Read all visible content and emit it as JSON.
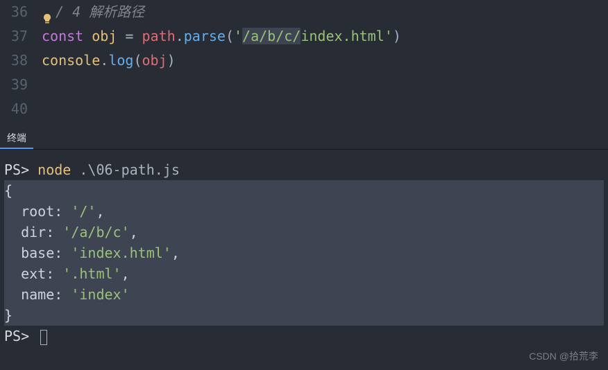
{
  "editor": {
    "line_numbers": [
      "36",
      "37",
      "38",
      "39",
      "40"
    ],
    "line36": {
      "bulb": "lightbulb-icon",
      "comment_marker": "/",
      "comment_num": " 4 ",
      "comment_text": "解析路径"
    },
    "line37": {
      "const": "const",
      "obj": "obj",
      "eq": " = ",
      "path": "path",
      "dot1": ".",
      "parse": "parse",
      "lparen": "(",
      "q1": "'",
      "str_hl": "/a/b/c/",
      "str_rest": "index.html",
      "q2": "'",
      "rparen": ")"
    },
    "line38": {
      "console": "console",
      "dot": ".",
      "log": "log",
      "lparen": "(",
      "obj": "obj",
      "rparen": ")"
    }
  },
  "terminal": {
    "tab_label": "终端",
    "prompt": "PS>",
    "cmd_name": "node",
    "cmd_arg": ".\\06-path.js",
    "output": {
      "open": "{",
      "root_key": "  root: ",
      "root_val": "'/'",
      "comma": ",",
      "dir_key": "  dir: ",
      "dir_val": "'/a/b/c'",
      "base_key": "  base: ",
      "base_val": "'index.html'",
      "ext_key": "  ext: ",
      "ext_val": "'.html'",
      "name_key": "  name: ",
      "name_val": "'index'",
      "close": "}"
    }
  },
  "watermark": "CSDN @拾荒李",
  "chart_data": {
    "type": "table",
    "title": "path.parse output",
    "input": "/a/b/c/index.html",
    "rows": [
      {
        "key": "root",
        "value": "/"
      },
      {
        "key": "dir",
        "value": "/a/b/c"
      },
      {
        "key": "base",
        "value": "index.html"
      },
      {
        "key": "ext",
        "value": ".html"
      },
      {
        "key": "name",
        "value": "index"
      }
    ]
  }
}
